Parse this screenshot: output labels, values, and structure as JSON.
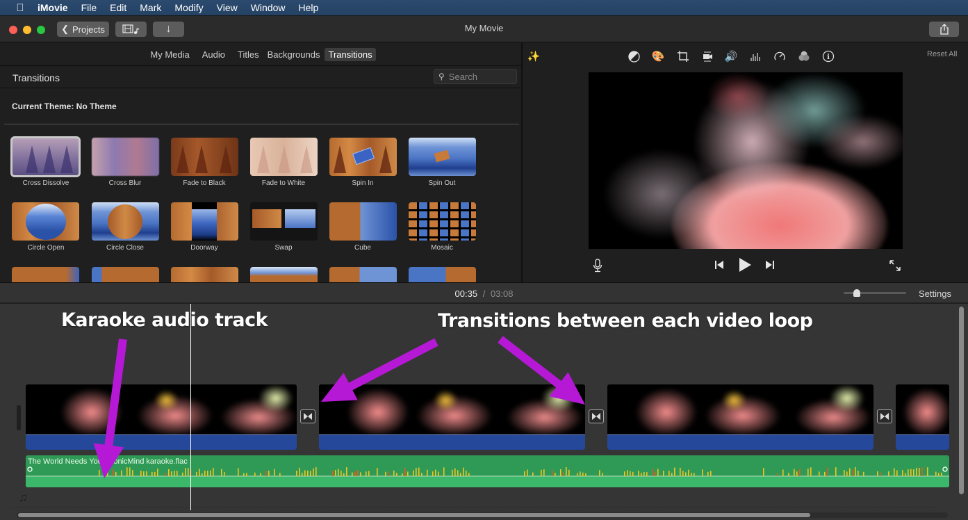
{
  "menubar": {
    "apple_icon": "apple-logo",
    "items": [
      "iMovie",
      "File",
      "Edit",
      "Mark",
      "Modify",
      "View",
      "Window",
      "Help"
    ]
  },
  "titlebar": {
    "title": "My Movie",
    "projects_label": "Projects",
    "media_toggle_icon": "film-music-icon",
    "import_icon": "download-arrow-icon",
    "share_icon": "share-icon"
  },
  "browser": {
    "tabs": [
      "My Media",
      "Audio",
      "Titles",
      "Backgrounds",
      "Transitions"
    ],
    "active_tab": "Transitions",
    "section_title": "Transitions",
    "search_placeholder": "Search",
    "current_theme": "Current Theme: No Theme",
    "transitions": [
      {
        "label": "Cross Dissolve",
        "selected": true
      },
      {
        "label": "Cross Blur"
      },
      {
        "label": "Fade to Black"
      },
      {
        "label": "Fade to White"
      },
      {
        "label": "Spin In"
      },
      {
        "label": "Spin Out"
      },
      {
        "label": "Circle Open"
      },
      {
        "label": "Circle Close"
      },
      {
        "label": "Doorway"
      },
      {
        "label": "Swap"
      },
      {
        "label": "Cube"
      },
      {
        "label": "Mosaic"
      }
    ]
  },
  "viewer": {
    "tools": [
      "magic-wand",
      "color-balance",
      "color-correction",
      "crop",
      "stabilization",
      "volume",
      "noise-reduction-equalizer",
      "speed",
      "clip-filter",
      "info"
    ],
    "reset_all": "Reset All",
    "controls": [
      "microphone",
      "skip-back",
      "play",
      "skip-forward",
      "fullscreen"
    ]
  },
  "timeline": {
    "current_time": "00:35",
    "separator": "/",
    "total_time": "03:08",
    "settings_label": "Settings",
    "zoom_level": 0.2,
    "audio_clip_name": "The World Needs You PhonicMind karaoke.flac",
    "transition_icon": "bowtie-transition-icon",
    "video_clip_count": 4,
    "transition_count": 3
  },
  "annotations": {
    "left": "Karaoke audio track",
    "right": "Transitions between each video loop",
    "arrow_color": "#b619d6"
  },
  "colors": {
    "audio_green": "#2e9a55",
    "clip_audio_blue": "#26489a",
    "waveform_yellow": "#f2c522"
  }
}
